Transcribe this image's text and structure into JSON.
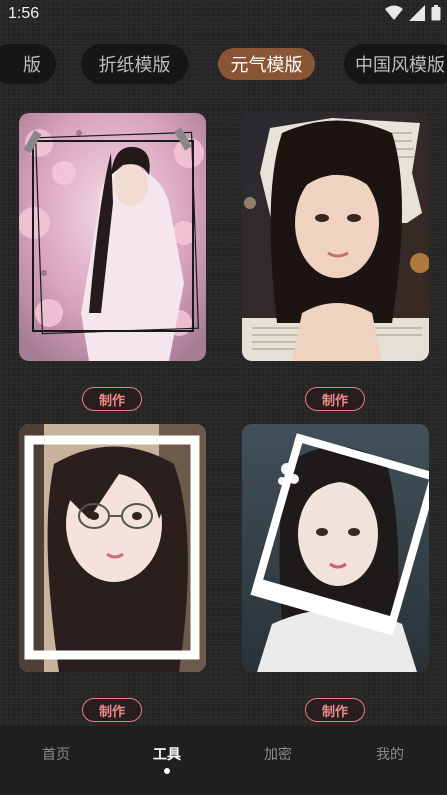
{
  "status_bar": {
    "time": "1:56",
    "icons": [
      "wifi-icon",
      "signal-icon",
      "battery-icon"
    ]
  },
  "tabs": [
    {
      "label": "版",
      "active": false
    },
    {
      "label": "折纸模版",
      "active": false
    },
    {
      "label": "元气模版",
      "active": true
    },
    {
      "label": "中国风模版",
      "active": false
    }
  ],
  "cards": [
    {
      "button": "制作"
    },
    {
      "button": "制作"
    },
    {
      "button": "制作"
    },
    {
      "button": "制作"
    }
  ],
  "bottom_nav": [
    {
      "label": "首页",
      "active": false
    },
    {
      "label": "工具",
      "active": true
    },
    {
      "label": "加密",
      "active": false
    },
    {
      "label": "我的",
      "active": false
    }
  ],
  "colors": {
    "accent": "#8a5535",
    "button_border": "#e77d7d",
    "background": "#262626"
  }
}
